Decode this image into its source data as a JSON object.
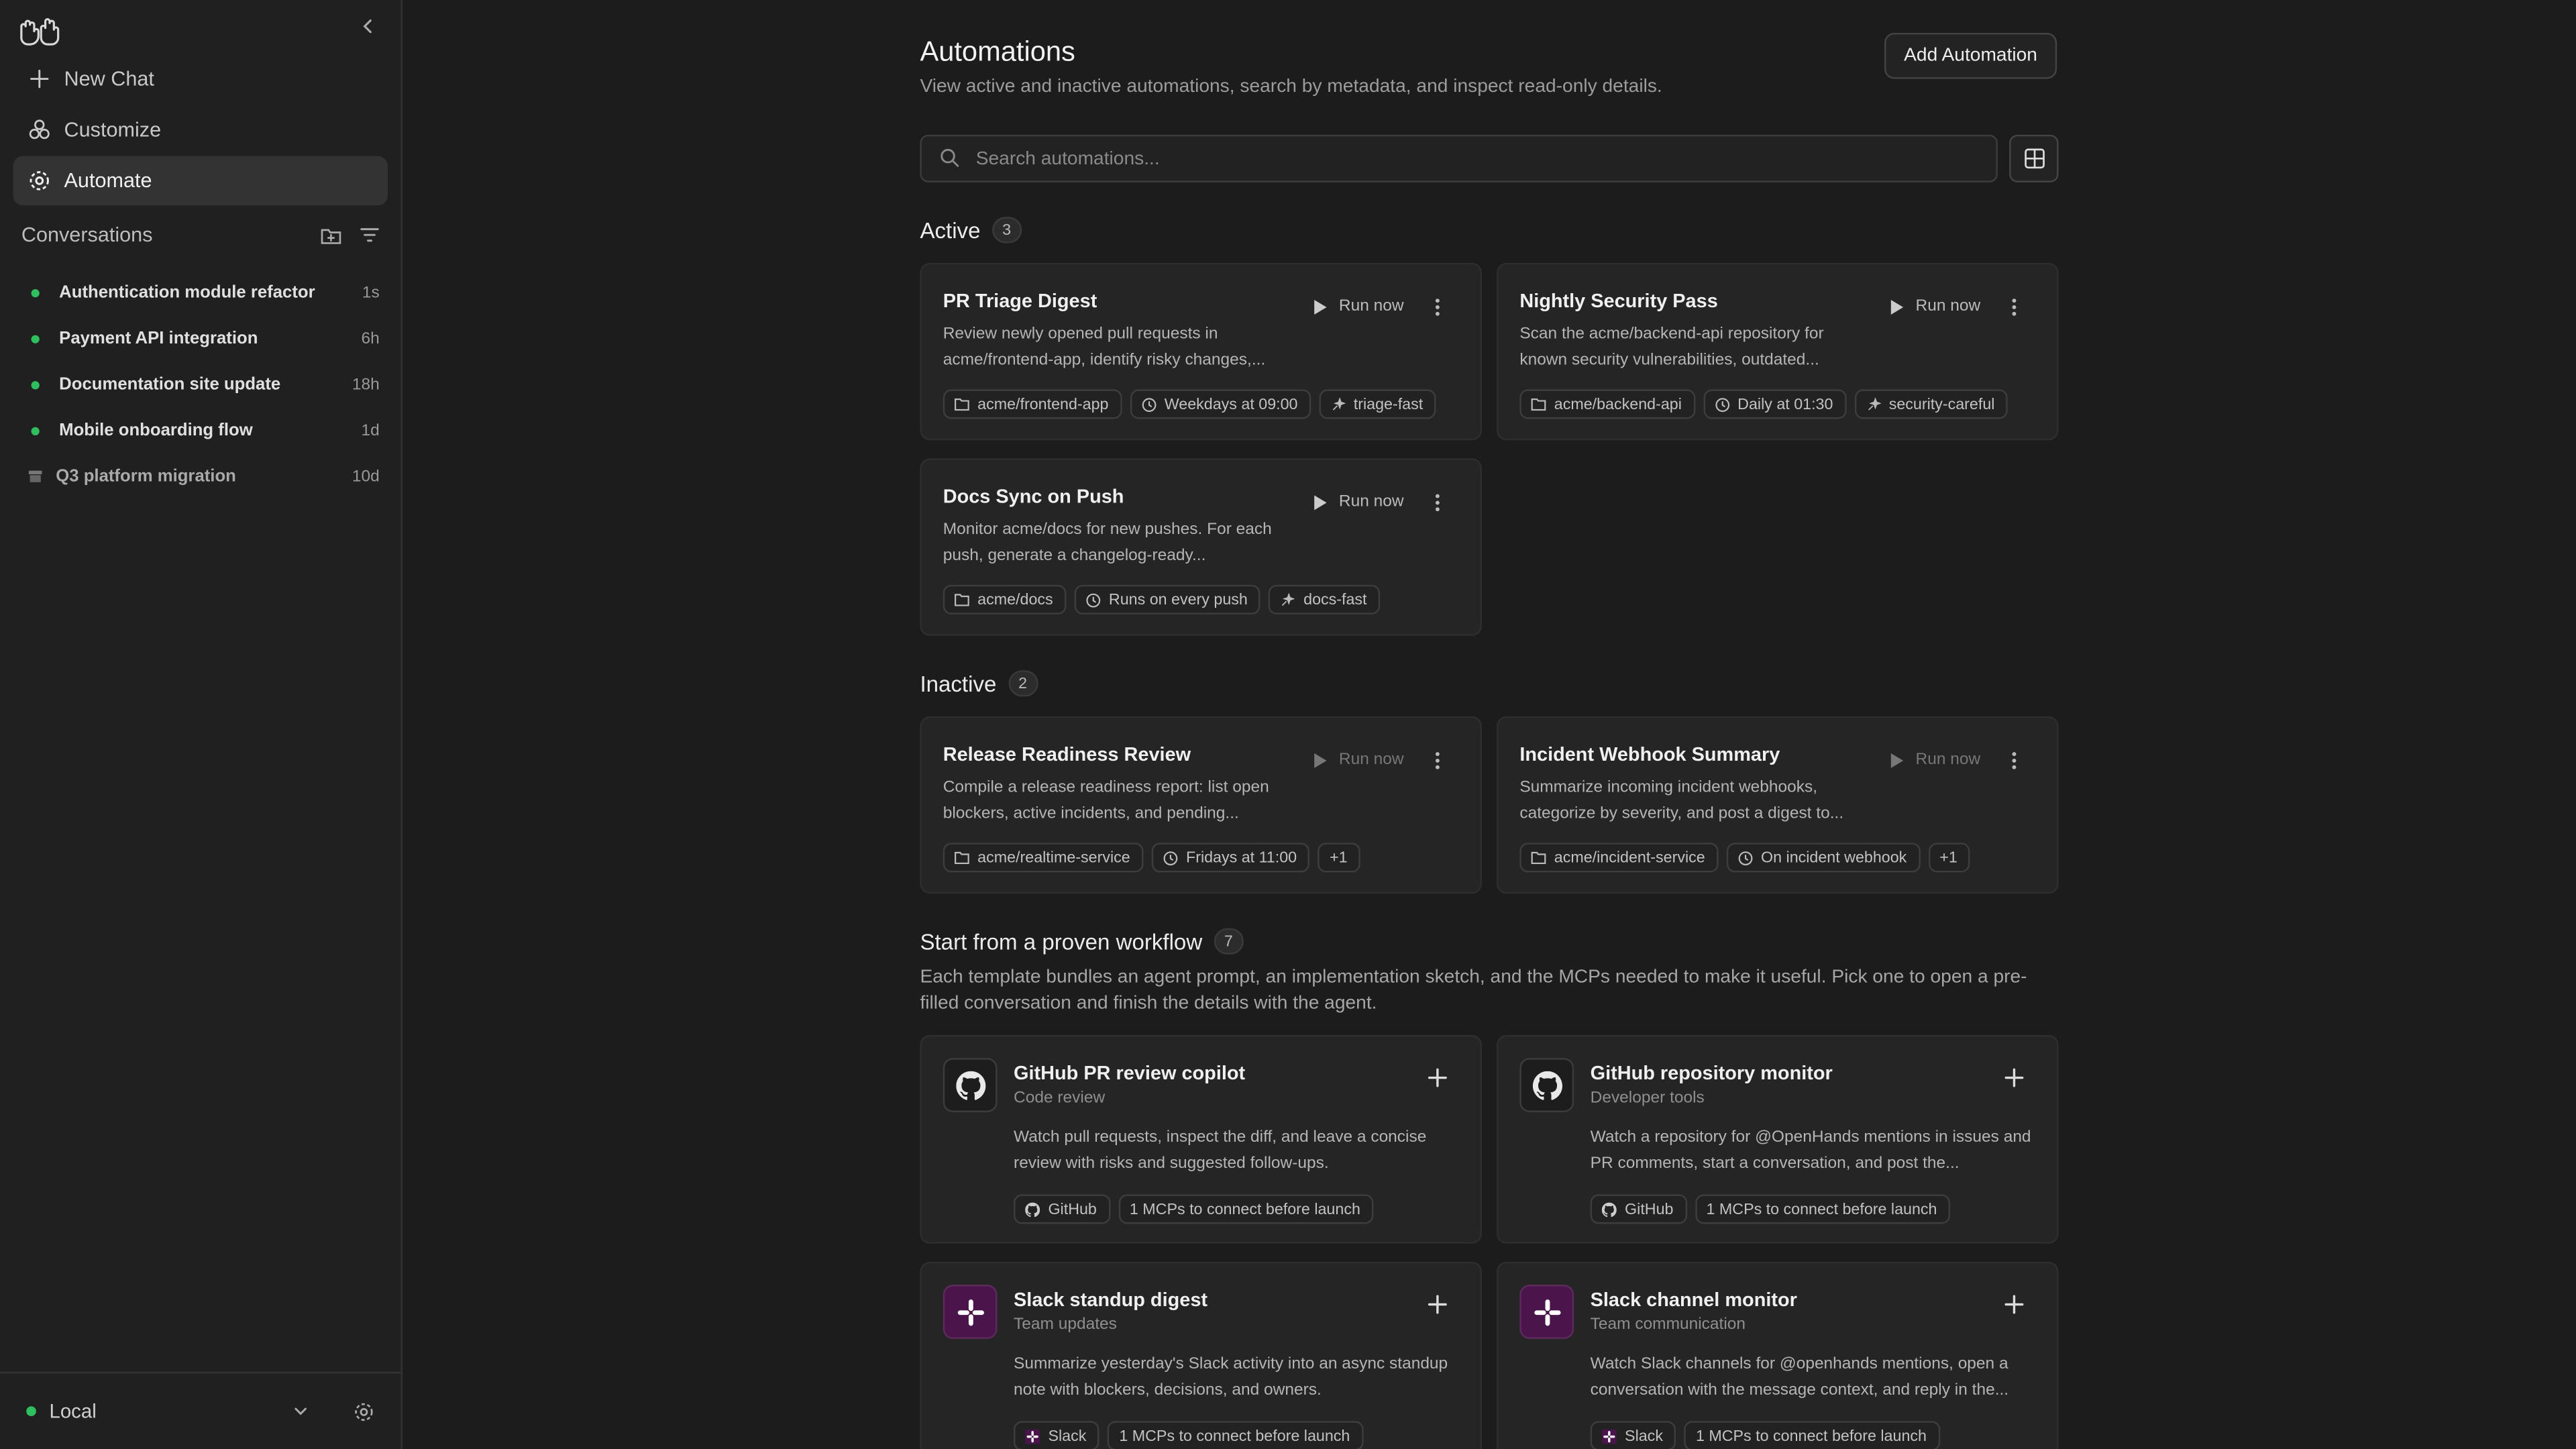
{
  "sidebar": {
    "nav": [
      {
        "label": "New Chat",
        "icon": "plus-icon"
      },
      {
        "label": "Customize",
        "icon": "customize-icon"
      },
      {
        "label": "Automate",
        "icon": "gear-icon",
        "active": true
      }
    ],
    "conversations_title": "Conversations",
    "conversations": [
      {
        "label": "Authentication module refactor",
        "time": "1s",
        "status": "active"
      },
      {
        "label": "Payment API integration",
        "time": "6h",
        "status": "active"
      },
      {
        "label": "Documentation site update",
        "time": "18h",
        "status": "active"
      },
      {
        "label": "Mobile onboarding flow",
        "time": "1d",
        "status": "active"
      },
      {
        "label": "Q3 platform migration",
        "time": "10d",
        "status": "archived"
      }
    ],
    "footer": {
      "environment": "Local",
      "status_color": "#2fbf5f"
    }
  },
  "main": {
    "title": "Automations",
    "subtitle": "View active and inactive automations, search by metadata, and inspect read-only details.",
    "add_button": "Add Automation",
    "search_placeholder": "Search automations...",
    "active": {
      "title": "Active",
      "count": "3",
      "cards": [
        {
          "title": "PR Triage Digest",
          "desc": "Review newly opened pull requests in acme/frontend-app, identify risky changes,...",
          "run": "Run now",
          "chips": [
            "acme/frontend-app",
            "Weekdays at 09:00",
            "triage-fast"
          ]
        },
        {
          "title": "Nightly Security Pass",
          "desc": "Scan the acme/backend-api repository for known security vulnerabilities, outdated...",
          "run": "Run now",
          "chips": [
            "acme/backend-api",
            "Daily at 01:30",
            "security-careful"
          ]
        },
        {
          "title": "Docs Sync on Push",
          "desc": "Monitor acme/docs for new pushes. For each push, generate a changelog-ready...",
          "run": "Run now",
          "chips": [
            "acme/docs",
            "Runs on every push",
            "docs-fast"
          ]
        }
      ]
    },
    "inactive": {
      "title": "Inactive",
      "count": "2",
      "cards": [
        {
          "title": "Release Readiness Review",
          "desc": "Compile a release readiness report: list open blockers, active incidents, and pending...",
          "run": "Run now",
          "chips": [
            "acme/realtime-service",
            "Fridays at 11:00",
            "+1"
          ]
        },
        {
          "title": "Incident Webhook Summary",
          "desc": "Summarize incoming incident webhooks, categorize by severity, and post a digest to...",
          "run": "Run now",
          "chips": [
            "acme/incident-service",
            "On incident webhook",
            "+1"
          ]
        }
      ]
    },
    "workflows": {
      "title": "Start from a proven workflow",
      "count": "7",
      "desc": "Each template bundles an agent prompt, an implementation sketch, and the MCPs needed to make it useful. Pick one to open a pre-filled conversation and finish the details with the agent.",
      "cards": [
        {
          "title": "GitHub PR review copilot",
          "category": "Code review",
          "desc": "Watch pull requests, inspect the diff, and leave a concise review with risks and suggested follow-ups.",
          "icon": "github-icon",
          "chips": [
            "GitHub",
            "1 MCPs to connect before launch"
          ]
        },
        {
          "title": "GitHub repository monitor",
          "category": "Developer tools",
          "desc": "Watch a repository for @OpenHands mentions in issues and PR comments, start a conversation, and post the...",
          "icon": "github-icon",
          "chips": [
            "GitHub",
            "1 MCPs to connect before launch"
          ]
        },
        {
          "title": "Slack standup digest",
          "category": "Team updates",
          "desc": "Summarize yesterday's Slack activity into an async standup note with blockers, decisions, and owners.",
          "icon": "slack-icon",
          "chips": [
            "Slack",
            "1 MCPs to connect before launch"
          ]
        },
        {
          "title": "Slack channel monitor",
          "category": "Team communication",
          "desc": "Watch Slack channels for @openhands mentions, open a conversation with the message context, and reply in the...",
          "icon": "slack-icon",
          "chips": [
            "Slack",
            "1 MCPs to connect before launch"
          ]
        }
      ]
    }
  },
  "colors": {
    "background": "#1c1c1c",
    "sidebar": "#202020",
    "card": "#252525",
    "active_dot": "#2fbf5f",
    "slack_brand": "#4a154b"
  }
}
